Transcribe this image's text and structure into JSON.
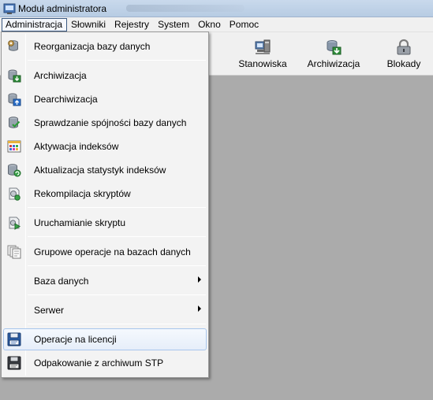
{
  "window": {
    "title": "Moduł administratora"
  },
  "menubar": {
    "items": [
      "Administracja",
      "Słowniki",
      "Rejestry",
      "System",
      "Okno",
      "Pomoc"
    ],
    "active": "Administracja"
  },
  "toolbar": {
    "buttons": [
      {
        "label": "Stanowiska",
        "icon": "computer-icon"
      },
      {
        "label": "Archiwizacja",
        "icon": "archive-db-icon"
      },
      {
        "label": "Blokady",
        "icon": "lock-icon"
      }
    ]
  },
  "dropdown": {
    "items": [
      {
        "label": "Reorganizacja bazy danych",
        "icon": "database-gear-icon"
      },
      {
        "label": "Archiwizacja",
        "icon": "archive-db-icon"
      },
      {
        "label": "Dearchiwizacja",
        "icon": "dearchive-db-icon"
      },
      {
        "label": "Sprawdzanie spójności bazy danych",
        "icon": "database-check-icon"
      },
      {
        "label": "Aktywacja indeksów",
        "icon": "index-grid-icon"
      },
      {
        "label": "Aktualizacja statystyk indeksów",
        "icon": "database-refresh-icon"
      },
      {
        "label": "Rekompilacja skryptów",
        "icon": "script-gear-icon"
      },
      {
        "label": "Uruchamianie skryptu",
        "icon": "run-script-icon"
      },
      {
        "label": "Grupowe operacje na bazach danych",
        "icon": "group-docs-icon"
      },
      {
        "label": "Baza danych",
        "icon": "",
        "submenu": true
      },
      {
        "label": "Serwer",
        "icon": "",
        "submenu": true
      },
      {
        "label": "Operacje na licencji",
        "icon": "license-floppy-icon",
        "highlighted": true
      },
      {
        "label": "Odpakowanie z archiwum STP",
        "icon": "unpack-floppy-icon"
      }
    ]
  },
  "colors": {
    "highlight_border": "#a8c6ec",
    "workspace": "#ababab",
    "menu_bg": "#f3f3f3"
  }
}
